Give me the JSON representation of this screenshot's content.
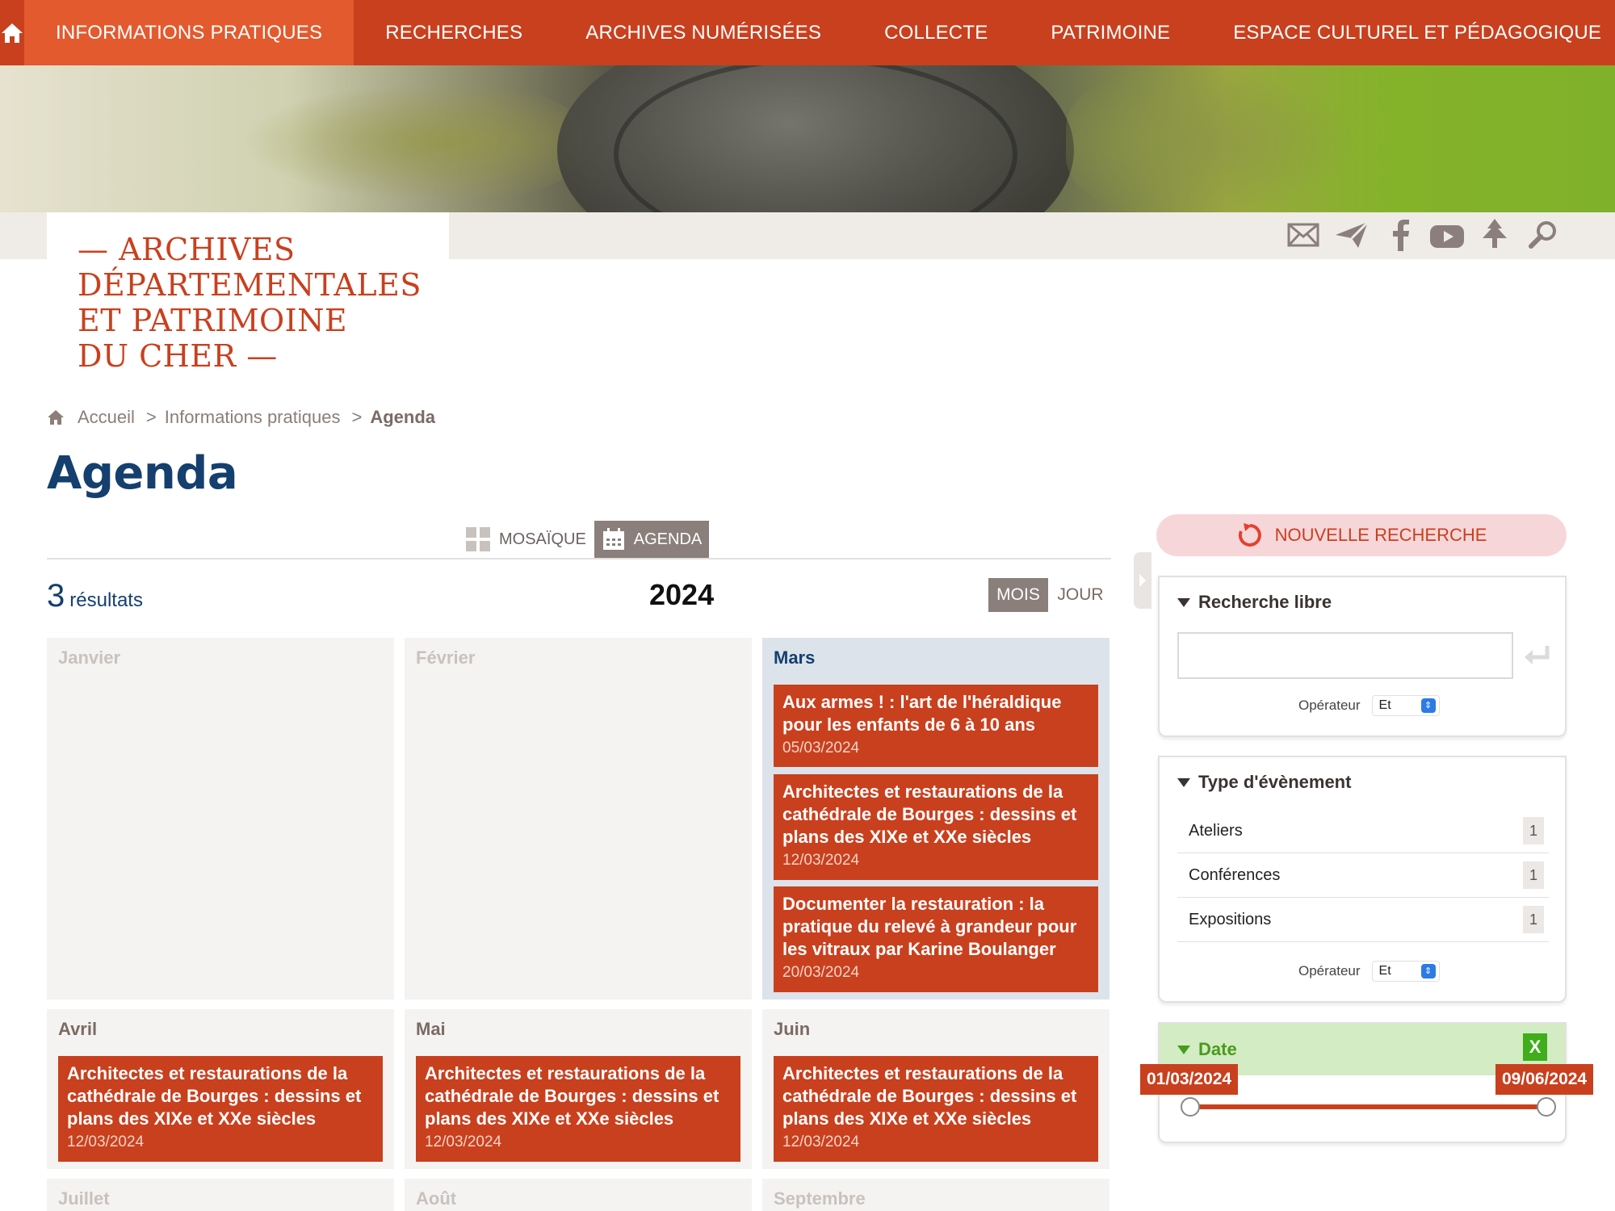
{
  "nav": {
    "items": [
      "INFORMATIONS PRATIQUES",
      "RECHERCHES",
      "ARCHIVES NUMÉRISÉES",
      "COLLECTE",
      "PATRIMOINE",
      "ESPACE CULTUREL ET PÉDAGOGIQUE"
    ]
  },
  "logo": {
    "line1": "— ARCHIVES",
    "line2": "DÉPARTEMENTALES",
    "line3": "ET PATRIMOINE",
    "line4": "DU CHER —"
  },
  "social_icons": [
    "mail-icon",
    "newsletter-icon",
    "facebook-icon",
    "youtube-icon",
    "tree-icon",
    "search-icon"
  ],
  "breadcrumb": {
    "home": "Accueil",
    "sep1": ">",
    "level2": "Informations pratiques",
    "sep2": ">",
    "current": "Agenda"
  },
  "page": {
    "title": "Agenda",
    "view_mosaic": "MOSAÏQUE",
    "view_agenda": "AGENDA",
    "results_count": "3",
    "results_label": "résultats",
    "year": "2024",
    "mode_month": "MOIS",
    "mode_day": "JOUR"
  },
  "months": [
    {
      "name": "Janvier",
      "events": []
    },
    {
      "name": "Février",
      "events": []
    },
    {
      "name": "Mars",
      "events": [
        {
          "title": "Aux armes ! : l'art de l'héraldique pour les enfants de 6 à 10 ans",
          "date": "05/03/2024"
        },
        {
          "title": "Architectes et restaurations de la cathédrale de Bourges : dessins et plans des XIXe et XXe siècles",
          "date": "12/03/2024"
        },
        {
          "title": "Documenter la restauration : la pratique du relevé à grandeur pour les vitraux par Karine Boulanger",
          "date": "20/03/2024"
        }
      ]
    },
    {
      "name": "Avril",
      "events": [
        {
          "title": "Architectes et restaurations de la cathédrale de Bourges : dessins et plans des XIXe et XXe siècles",
          "date": "12/03/2024"
        }
      ]
    },
    {
      "name": "Mai",
      "events": [
        {
          "title": "Architectes et restaurations de la cathédrale de Bourges : dessins et plans des XIXe et XXe siècles",
          "date": "12/03/2024"
        }
      ]
    },
    {
      "name": "Juin",
      "events": [
        {
          "title": "Architectes et restaurations de la cathédrale de Bourges : dessins et plans des XIXe et XXe siècles",
          "date": "12/03/2024"
        }
      ]
    },
    {
      "name": "Juillet",
      "events": []
    },
    {
      "name": "Août",
      "events": []
    },
    {
      "name": "Septembre",
      "events": []
    }
  ],
  "sidebar": {
    "new_search": "NOUVELLE RECHERCHE",
    "free_search": {
      "title": "Recherche libre",
      "value": "",
      "operator_label": "Opérateur",
      "operator_value": "Et"
    },
    "event_type": {
      "title": "Type d'évènement",
      "items": [
        {
          "label": "Ateliers",
          "count": "1"
        },
        {
          "label": "Conférences",
          "count": "1"
        },
        {
          "label": "Expositions",
          "count": "1"
        }
      ],
      "operator_label": "Opérateur",
      "operator_value": "Et"
    },
    "date": {
      "title": "Date",
      "clear": "X",
      "start": "01/03/2024",
      "end": "09/06/2024"
    }
  },
  "colors": {
    "brand": "#c9401e",
    "nav_active": "#e35a2e",
    "title_blue": "#143f6f",
    "date_green": "#4a9a1c"
  }
}
